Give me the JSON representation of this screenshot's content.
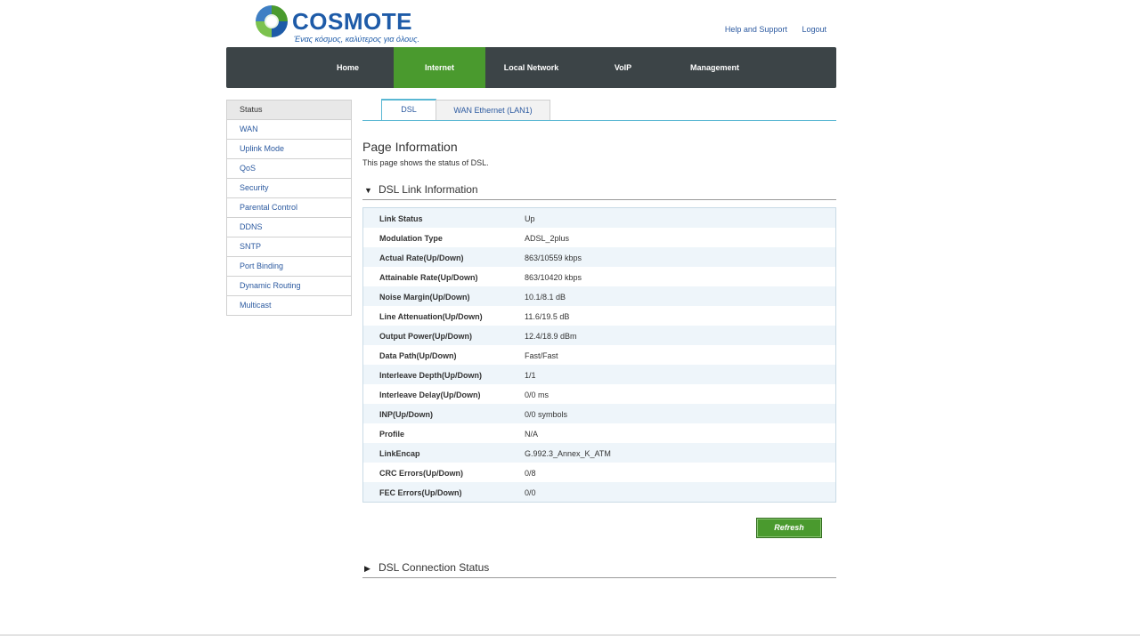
{
  "brand": {
    "name": "COSMOTE",
    "tagline": "Ένας κόσμος, καλύτερος για όλους.",
    "colors": {
      "blue": "#1e5ba8",
      "green": "#4a9a2e",
      "nav_bg": "#3c4447",
      "tab_accent": "#59b7d3"
    }
  },
  "header_links": {
    "help": "Help and Support",
    "logout": "Logout"
  },
  "mainnav": [
    {
      "label": "Home",
      "active": false
    },
    {
      "label": "Internet",
      "active": true
    },
    {
      "label": "Local Network",
      "active": false
    },
    {
      "label": "VoIP",
      "active": false
    },
    {
      "label": "Management",
      "active": false
    }
  ],
  "sidebar": [
    {
      "label": "Status",
      "active": true
    },
    {
      "label": "WAN",
      "active": false
    },
    {
      "label": "Uplink Mode",
      "active": false
    },
    {
      "label": "QoS",
      "active": false
    },
    {
      "label": "Security",
      "active": false
    },
    {
      "label": "Parental Control",
      "active": false
    },
    {
      "label": "DDNS",
      "active": false
    },
    {
      "label": "SNTP",
      "active": false
    },
    {
      "label": "Port Binding",
      "active": false
    },
    {
      "label": "Dynamic Routing",
      "active": false
    },
    {
      "label": "Multicast",
      "active": false
    }
  ],
  "tabs": [
    {
      "label": "DSL",
      "active": true
    },
    {
      "label": "WAN Ethernet (LAN1)",
      "active": false
    }
  ],
  "page": {
    "title": "Page Information",
    "description": "This page shows the status of DSL."
  },
  "sections": {
    "link_info": {
      "title": "DSL Link Information",
      "expanded": true,
      "icon": "triangle-down-icon"
    },
    "connection_status": {
      "title": "DSL Connection Status",
      "expanded": false,
      "icon": "triangle-right-icon"
    }
  },
  "link_info_rows": [
    {
      "label": "Link Status",
      "value": "Up"
    },
    {
      "label": "Modulation Type",
      "value": "ADSL_2plus"
    },
    {
      "label": "Actual Rate(Up/Down)",
      "value": "863/10559 kbps"
    },
    {
      "label": "Attainable Rate(Up/Down)",
      "value": "863/10420 kbps"
    },
    {
      "label": "Noise Margin(Up/Down)",
      "value": "10.1/8.1 dB"
    },
    {
      "label": "Line Attenuation(Up/Down)",
      "value": "11.6/19.5 dB"
    },
    {
      "label": "Output Power(Up/Down)",
      "value": "12.4/18.9 dBm"
    },
    {
      "label": "Data Path(Up/Down)",
      "value": "Fast/Fast"
    },
    {
      "label": "Interleave Depth(Up/Down)",
      "value": "1/1"
    },
    {
      "label": "Interleave Delay(Up/Down)",
      "value": "0/0 ms"
    },
    {
      "label": "INP(Up/Down)",
      "value": "0/0 symbols"
    },
    {
      "label": "Profile",
      "value": "N/A"
    },
    {
      "label": "LinkEncap",
      "value": "G.992.3_Annex_K_ATM"
    },
    {
      "label": "CRC Errors(Up/Down)",
      "value": "0/8"
    },
    {
      "label": "FEC Errors(Up/Down)",
      "value": "0/0"
    }
  ],
  "buttons": {
    "refresh": "Refresh"
  }
}
